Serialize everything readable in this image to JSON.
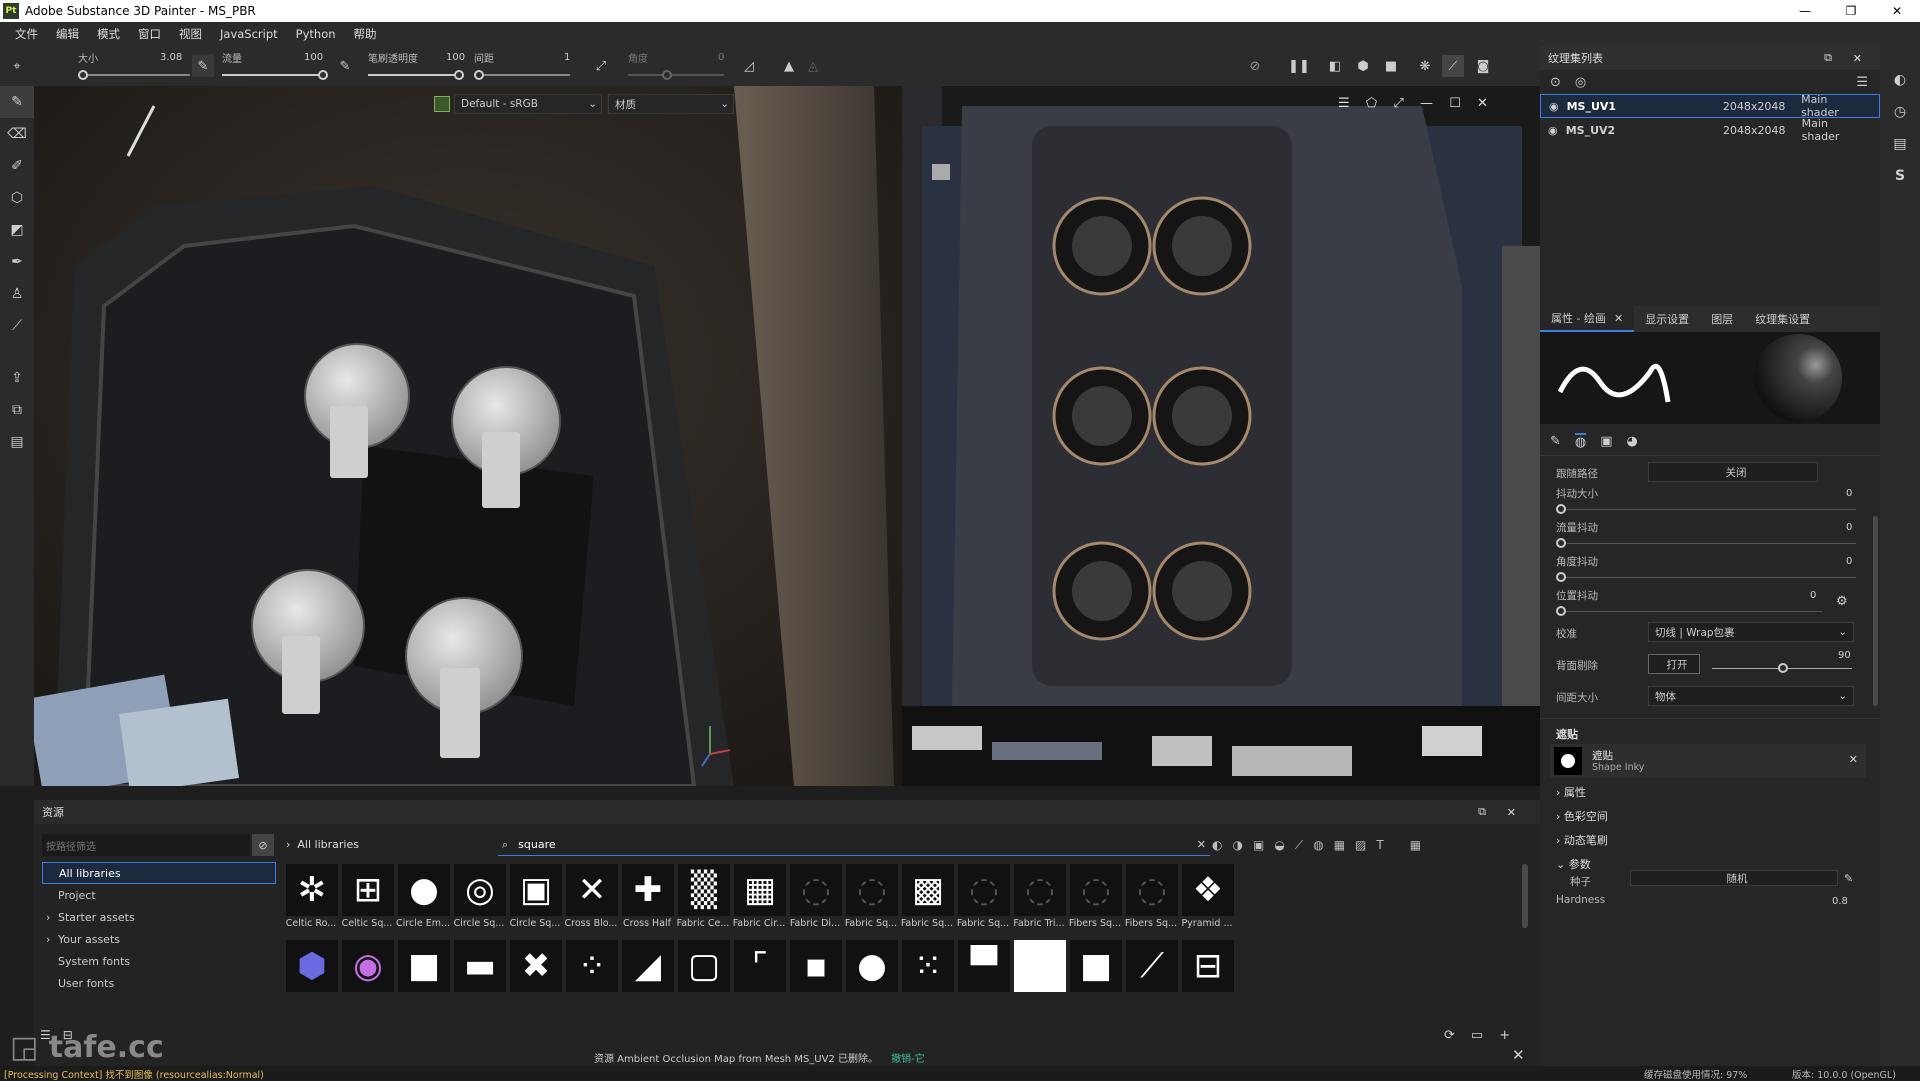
{
  "window": {
    "title": "Adobe Substance 3D Painter - MS_PBR",
    "logo_text": "Pt",
    "minimize": "—",
    "maximize": "❐",
    "close": "✕"
  },
  "menu": [
    "文件",
    "编辑",
    "模式",
    "窗口",
    "视图",
    "JavaScript",
    "Python",
    "帮助"
  ],
  "toolbar": {
    "size_label": "大小",
    "size_value": "3.08",
    "flow_label": "流量",
    "flow_value": "100",
    "opacity_label": "笔刷透明度",
    "opacity_value": "100",
    "spacing_label": "间距",
    "spacing_value": "1",
    "angle_label": "角度",
    "angle_value": "0"
  },
  "viewport": {
    "colorspace": "Default - sRGB",
    "mode": "材质"
  },
  "texture_sets": {
    "title": "纹理集列表",
    "items": [
      {
        "name": "MS_UV1",
        "size": "2048x2048",
        "shader": "Main shader",
        "selected": true
      },
      {
        "name": "MS_UV2",
        "size": "2048x2048",
        "shader": "Main shader",
        "selected": false
      }
    ]
  },
  "properties": {
    "tabs": [
      "属性 - 绘画",
      "显示设置",
      "图层",
      "纹理集设置"
    ],
    "follow_path_label": "跟随路径",
    "follow_path_value": "关闭",
    "jitter_size_label": "抖动大小",
    "jitter_size_value": "0",
    "flow_jitter_label": "流量抖动",
    "flow_jitter_value": "0",
    "angle_jitter_label": "角度抖动",
    "angle_jitter_value": "0",
    "pos_jitter_label": "位置抖动",
    "pos_jitter_value": "0",
    "align_label": "校准",
    "align_value": "切线 | Wrap包裹",
    "backface_label": "背面剔除",
    "backface_value": "打开",
    "backface_num": "90",
    "spacing_size_label": "间距大小",
    "spacing_size_value": "物体",
    "stencil_section": "遮贴",
    "stencil_name": "遮贴",
    "stencil_sub": "Shape Inky",
    "sub_sections": [
      "属性",
      "色彩空间",
      "动态笔刷"
    ],
    "params_section": "参数",
    "seed_label": "种子",
    "seed_value": "随机",
    "hardness_label": "Hardness",
    "hardness_value": "0.8"
  },
  "assets": {
    "title": "资源",
    "filter_placeholder": "按路径筛选",
    "breadcrumb": "All libraries",
    "search_value": "square",
    "libraries": [
      {
        "label": "All libraries",
        "active": true,
        "expand": false
      },
      {
        "label": "Project",
        "active": false,
        "expand": false
      },
      {
        "label": "Starter assets",
        "active": false,
        "expand": true
      },
      {
        "label": "Your assets",
        "active": false,
        "expand": true
      },
      {
        "label": "System fonts",
        "active": false,
        "expand": false
      },
      {
        "label": "User fonts",
        "active": false,
        "expand": false
      }
    ],
    "row1": [
      "Celtic Ro...",
      "Celtic Sq...",
      "Circle Em...",
      "Circle Sq...",
      "Circle Sq...",
      "Cross Blo...",
      "Cross Half",
      "Fabric Ce...",
      "Fabric Cir...",
      "Fabric Di...",
      "Fabric Sq...",
      "Fabric Sq...",
      "Fabric Sq...",
      "Fabric Tri...",
      "Fibers Sq...",
      "Fibers Sq...",
      "Pyramid ..."
    ],
    "status_msg": "资源 Ambient Occlusion Map from Mesh MS_UV2 已删除。",
    "undo": "撤销-它"
  },
  "status": {
    "left": "[Processing Context] 找不到图像 (resourcealias:Normal)",
    "cache": "缓存磁盘使用情况: 97%",
    "version": "版本: 10.0.0 (OpenGL)"
  },
  "watermark": "tafe.cc"
}
